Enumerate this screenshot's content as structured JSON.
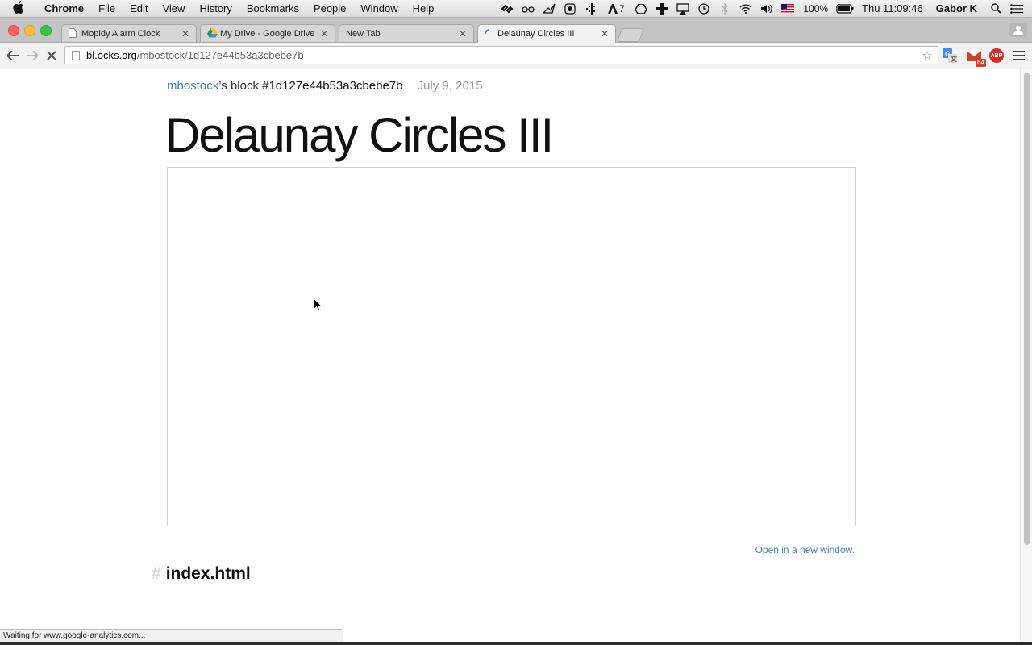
{
  "menubar": {
    "app_name": "Chrome",
    "items": [
      "File",
      "Edit",
      "View",
      "History",
      "Bookmarks",
      "People",
      "Window",
      "Help"
    ],
    "status": {
      "tray_label_7": "7",
      "battery": "100%",
      "clock": "Thu 11:09:46",
      "user": "Gabor K"
    }
  },
  "tabs": [
    {
      "title": "Mopidy Alarm Clock",
      "icon": "document-icon"
    },
    {
      "title": "My Drive - Google Drive",
      "icon": "google-drive-icon"
    },
    {
      "title": "New Tab",
      "icon": ""
    },
    {
      "title": "Delaunay Circles III",
      "icon": "loading-spinner-icon",
      "active": true
    }
  ],
  "toolbar": {
    "url_host": "bl.ocks.org",
    "url_path": "/mbostock/1d127e44b53a3cbebe7b",
    "gmail_badge": "64",
    "abp_label": "ABP"
  },
  "page": {
    "author": "mbostock",
    "block_text": "’s block",
    "block_hash": "#1d127e44b53a3cbebe7b",
    "date": "July 9, 2015",
    "title": "Delaunay Circles III",
    "open_link": "Open in a new window.",
    "file_heading_mark": "#",
    "file_heading": "index.html"
  },
  "statusbar": {
    "text": "Waiting for www.google-analytics.com..."
  },
  "colors": {
    "link": "#4682b4",
    "close": "#fc605c",
    "minimize": "#fdbc40",
    "maximize": "#34c84a"
  }
}
